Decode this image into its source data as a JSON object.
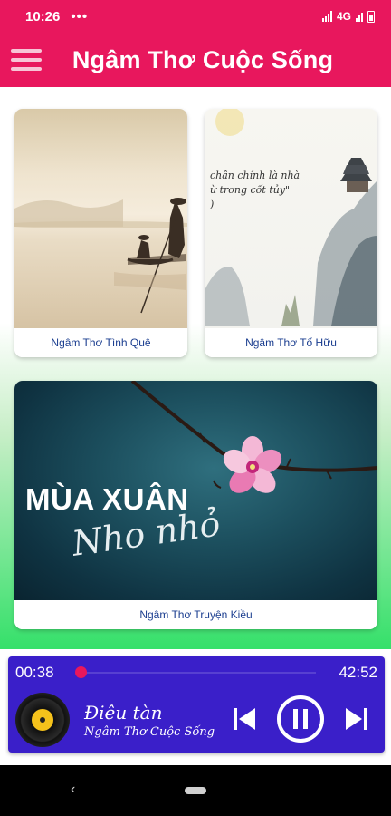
{
  "status_bar": {
    "time": "10:26",
    "dots": "•••",
    "network": "4G"
  },
  "app_bar": {
    "title": "Ngâm Thơ Cuộc Sống",
    "menu_icon": "hamburger-menu-icon"
  },
  "cards": [
    {
      "label": "Ngâm Thơ Tình Quê"
    },
    {
      "label": "Ngâm Thơ Tố Hữu",
      "art_text_line1": "chân chính là nhà",
      "art_text_line2": "ừ trong cốt tủy\"",
      "art_text_line3": ")"
    },
    {
      "label": "Ngâm Thơ Truyện Kiều",
      "banner_title": "MÙA XUÂN",
      "banner_subtitle": "Nho nhỏ"
    }
  ],
  "player": {
    "current_time": "00:38",
    "total_time": "42:52",
    "progress": 0.015,
    "song_title": "Điêu tàn",
    "artist": "Ngâm Thơ Cuộc Sống",
    "accent_color": "#e8175d",
    "bg_color": "#3a1fc9"
  },
  "colors": {
    "primary": "#e8175d",
    "label_text": "#1a3d8f"
  }
}
